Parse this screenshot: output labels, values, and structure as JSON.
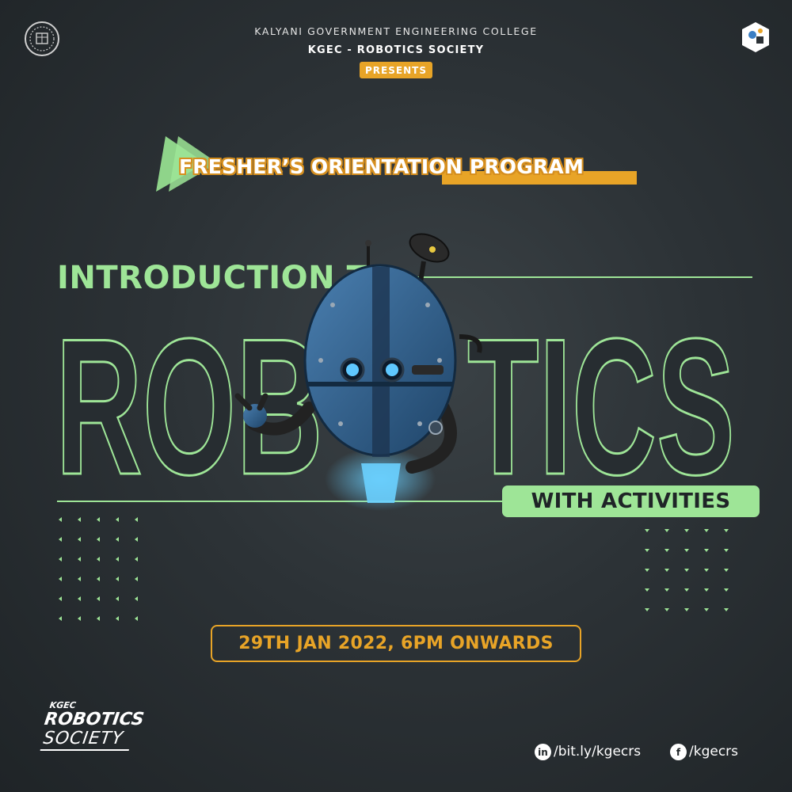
{
  "header": {
    "college": "KALYANI GOVERNMENT ENGINEERING COLLEGE",
    "society": "KGEC - ROBOTICS SOCIETY",
    "presents": "PRESENTS"
  },
  "program": {
    "banner": "FRESHER’S ORIENTATION PROGRAM"
  },
  "title": {
    "line1": "INTRODUCTION TO",
    "big_left": "ROB",
    "big_right": "TICS",
    "subtitle": "WITH ACTIVITIES"
  },
  "event": {
    "date": "29TH JAN 2022, 6PM ONWARDS"
  },
  "footer": {
    "logo_line1": "KGEC",
    "logo_line2": "ROBOTICS",
    "logo_line3": "SOCIETY",
    "linkedin_icon_text": "in",
    "linkedin_text": "/bit.ly/kgecrs",
    "facebook_icon_text": "f",
    "facebook_text": "/kgecrs"
  },
  "colors": {
    "accent_green": "#9ee597",
    "accent_orange": "#e8a427",
    "background": "#2c3236",
    "robot_blue": "#2d5f8f"
  },
  "icons": {
    "left_emblem": "college-emblem-icon",
    "right_emblem": "society-emblem-icon",
    "play": "play-arrow-icon",
    "robot": "robot-illustration",
    "linkedin": "linkedin-icon",
    "facebook": "facebook-icon"
  }
}
